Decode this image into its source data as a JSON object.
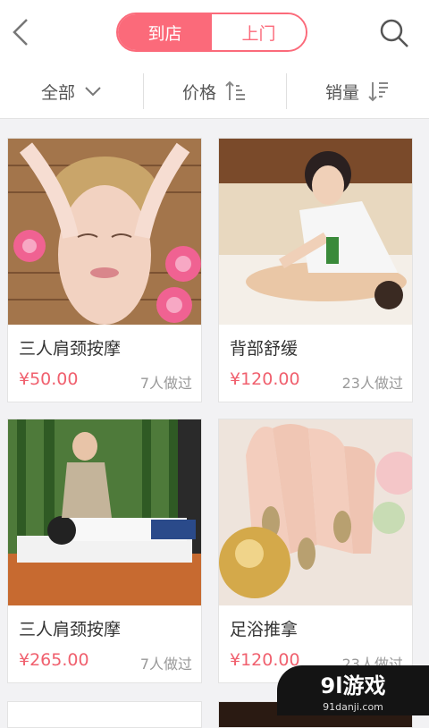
{
  "header": {
    "tabs": [
      {
        "label": "到店",
        "active": true
      },
      {
        "label": "上门",
        "active": false
      }
    ],
    "accent": "#fb6a7a"
  },
  "filters": [
    {
      "label": "全部",
      "icon": "chevron-down-icon"
    },
    {
      "label": "价格",
      "icon": "sort-ascending-icon"
    },
    {
      "label": "销量",
      "icon": "sort-descending-icon"
    }
  ],
  "products": [
    {
      "title": "三人肩颈按摩",
      "price": "¥50.00",
      "count": "7人做过"
    },
    {
      "title": "背部舒缓",
      "price": "¥120.00",
      "count": "23人做过"
    },
    {
      "title": "三人肩颈按摩",
      "price": "¥265.00",
      "count": "7人做过"
    },
    {
      "title": "足浴推拿",
      "price": "¥120.00",
      "count": "23人做过"
    }
  ],
  "watermark": {
    "text": "9l游戏",
    "sub": "91danji.com"
  }
}
